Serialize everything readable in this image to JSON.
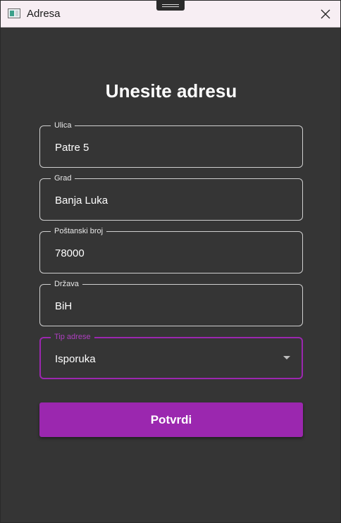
{
  "window": {
    "title": "Adresa"
  },
  "form": {
    "heading": "Unesite adresu",
    "fields": [
      {
        "label": "Ulica",
        "value": "Patre 5"
      },
      {
        "label": "Grad",
        "value": "Banja Luka"
      },
      {
        "label": "Poštanski broj",
        "value": "78000"
      },
      {
        "label": "Država",
        "value": "BiH"
      }
    ],
    "address_type": {
      "label": "Tip adrese",
      "value": "Isporuka"
    },
    "confirm_label": "Potvrdi"
  },
  "colors": {
    "accent": "#9b27af",
    "background": "#353535",
    "titlebar": "#f7eef3"
  },
  "icons": {
    "app": "window-app-icon",
    "close": "close-icon",
    "dropdown": "chevron-down-icon"
  }
}
